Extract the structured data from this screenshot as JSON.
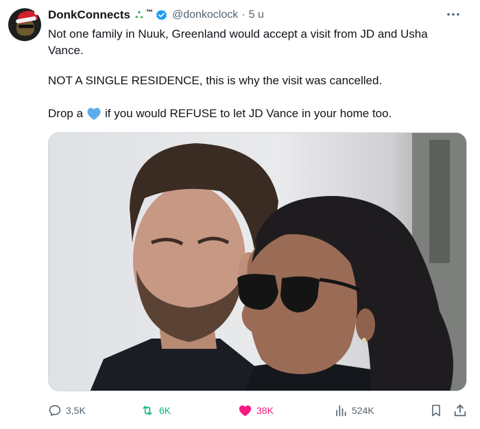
{
  "author": {
    "display_name": "DonkConnects",
    "badge_emoji": "recycling-symbol",
    "trademark": "™",
    "verified": true,
    "handle": "@donkoclock",
    "separator": "·",
    "time": "5 u"
  },
  "body": {
    "line1": "Not one family in Nuuk, Greenland would accept a visit from JD and Usha Vance.",
    "line2": "NOT A SINGLE RESIDENCE, this is why the visit was cancelled.",
    "line3_before": "Drop a",
    "line3_emoji": "blue-heart",
    "line3_after": "if you would REFUSE to let JD Vance in your home too."
  },
  "metrics": {
    "replies": "3,5K",
    "reposts": "6K",
    "likes": "38K",
    "views": "524K"
  },
  "colors": {
    "verified": "#1d9bf0",
    "repost_active": "#00ba7c",
    "like_active": "#f91880",
    "muted": "#536471",
    "heart_emoji": "#5dadec"
  },
  "icons": [
    "more-icon",
    "reply-icon",
    "repost-icon",
    "like-icon",
    "views-icon",
    "bookmark-icon",
    "share-icon"
  ]
}
